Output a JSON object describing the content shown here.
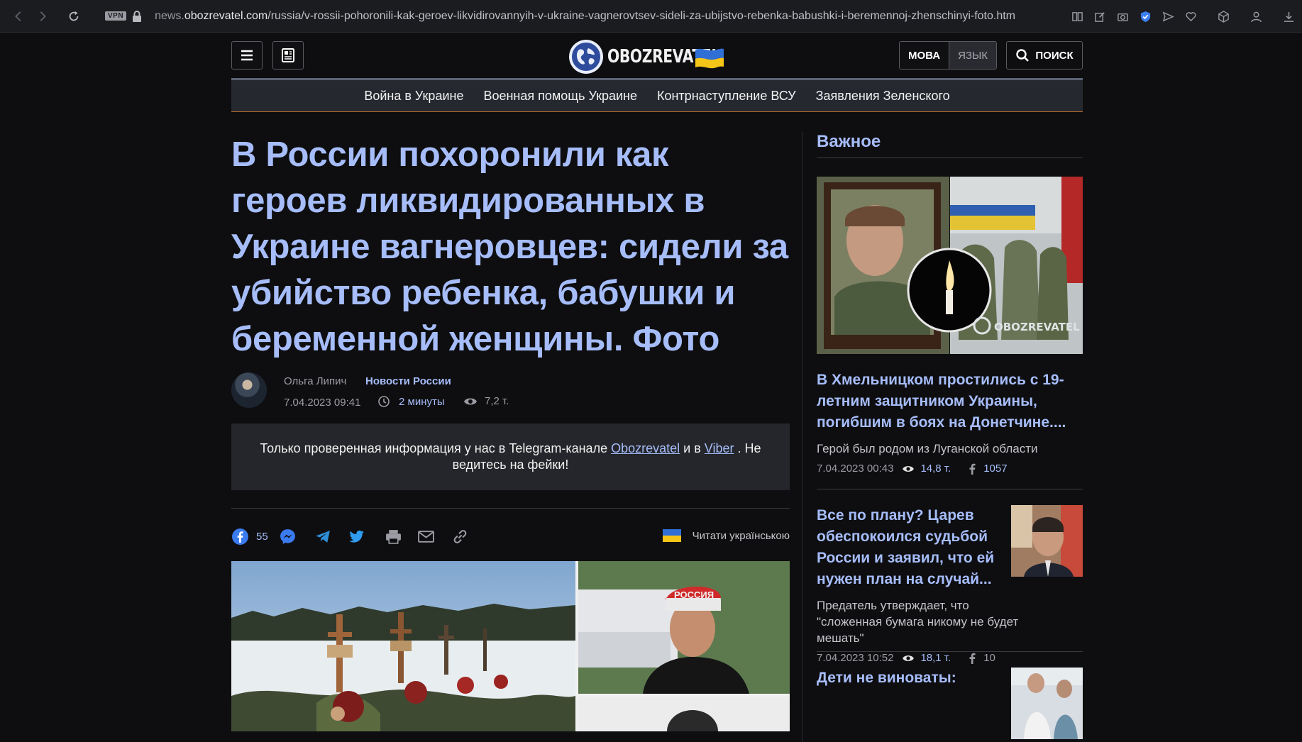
{
  "browser": {
    "vpn": "VPN",
    "url_domain_prefix": "news.",
    "url_domain": "obozrevatel.com",
    "url_path": "/russia/v-rossii-pohoronili-kak-geroev-likvidirovannyih-v-ukraine-vagnerovtsev-sideli-za-ubijstvo-rebenka-babushki-i-beremennoj-zhenschinyi-foto.htm"
  },
  "header": {
    "logo_text": "OBOZREVATEL",
    "lang_active": "МОВА",
    "lang_inactive": "ЯЗЫК",
    "search_label": "ПОИСК"
  },
  "topics": [
    "Война в Украине",
    "Военная помощь Украине",
    "Контрнаступление ВСУ",
    "Заявления Зеленского"
  ],
  "article": {
    "title": "В России похоронили как героев ликвидированных в Украине вагнеровцев: сидели за убийство ребенка, бабушки и беременной женщины. Фото",
    "author": "Ольга Липич",
    "category": "Новости России",
    "date": "7.04.2023 09:41",
    "read_time": "2 минуты",
    "views": "7,2 т.",
    "promo_text_1": "Только проверенная информация у нас в Telegram-канале ",
    "promo_link_1": "Obozrevatel",
    "promo_text_2": " и в ",
    "promo_link_2": "Viber",
    "promo_text_3": " . Не ведитесь на фейки!",
    "fb_shares": "55",
    "read_ukr": "Читати українською",
    "hero_shirt_text": "РОССИЯ"
  },
  "sidebar": {
    "heading": "Важное",
    "image_watermark": "OBOZREVATEL",
    "items": [
      {
        "title": "В Хмельницком простились с 19-летним защитником Украины, погибшим в боях на Донетчине....",
        "subtitle": "Герой был родом из Луганской области",
        "date": "7.04.2023 00:43",
        "views": "14,8 т.",
        "fb": "1057"
      },
      {
        "title": "Все по плану? Царев обеспокоился судьбой России и заявил, что ей нужен план на случай...",
        "subtitle": "Предатель утверждает, что \"сложенная бумага никому не будет мешать\"",
        "date": "7.04.2023 10:52",
        "views": "18,1 т.",
        "fb": "10"
      },
      {
        "title": "Дети не виноваты:"
      }
    ]
  },
  "colors": {
    "accent": "#a6bdfa",
    "background": "#0e0e10",
    "nav_bg": "#262830",
    "nav_bottom_line": "#b26a2a"
  }
}
